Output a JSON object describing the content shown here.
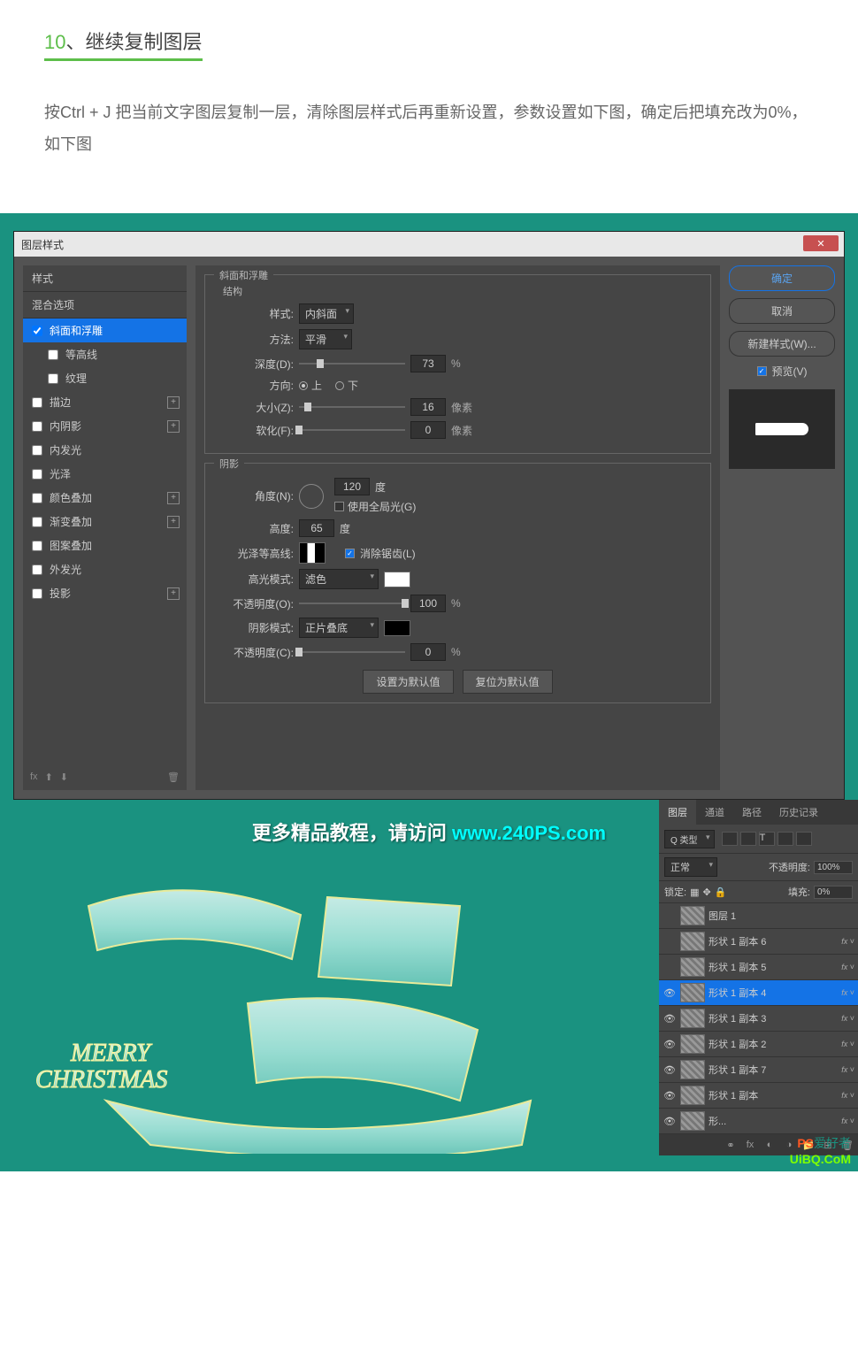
{
  "step": {
    "num": "10",
    "title": "、继续复制图层"
  },
  "desc": "按Ctrl + J 把当前文字图层复制一层，清除图层样式后再重新设置，参数设置如下图，确定后把填充改为0%，如下图",
  "dialog": {
    "title": "图层样式",
    "left": {
      "header1": "样式",
      "header2": "混合选项",
      "items": [
        {
          "label": "斜面和浮雕",
          "checked": true,
          "selected": true
        },
        {
          "label": "等高线",
          "sub": true
        },
        {
          "label": "纹理",
          "sub": true
        },
        {
          "label": "描边",
          "plus": true
        },
        {
          "label": "内阴影",
          "plus": true
        },
        {
          "label": "内发光"
        },
        {
          "label": "光泽"
        },
        {
          "label": "颜色叠加",
          "plus": true
        },
        {
          "label": "渐变叠加",
          "plus": true
        },
        {
          "label": "图案叠加"
        },
        {
          "label": "外发光"
        },
        {
          "label": "投影",
          "plus": true
        }
      ],
      "fx": "fx"
    },
    "bevel": {
      "group": "斜面和浮雕",
      "struct": "结构",
      "style_l": "样式:",
      "style_v": "内斜面",
      "method_l": "方法:",
      "method_v": "平滑",
      "depth_l": "深度(D):",
      "depth_v": "73",
      "depth_u": "%",
      "dir_l": "方向:",
      "dir_up": "上",
      "dir_down": "下",
      "size_l": "大小(Z):",
      "size_v": "16",
      "size_u": "像素",
      "soft_l": "软化(F):",
      "soft_v": "0",
      "soft_u": "像素"
    },
    "shade": {
      "group": "阴影",
      "angle_l": "角度(N):",
      "angle_v": "120",
      "angle_u": "度",
      "global_l": "使用全局光(G)",
      "alt_l": "高度:",
      "alt_v": "65",
      "alt_u": "度",
      "gloss_l": "光泽等高线:",
      "anti_l": "消除锯齿(L)",
      "hmode_l": "高光模式:",
      "hmode_v": "滤色",
      "hopac_l": "不透明度(O):",
      "hopac_v": "100",
      "hopac_u": "%",
      "smode_l": "阴影模式:",
      "smode_v": "正片叠底",
      "sopac_l": "不透明度(C):",
      "sopac_v": "0",
      "sopac_u": "%"
    },
    "btns": {
      "default": "设置为默认值",
      "reset": "复位为默认值"
    },
    "right": {
      "ok": "确定",
      "cancel": "取消",
      "new_style": "新建样式(W)...",
      "preview": "预览(V)"
    }
  },
  "watermark": {
    "text": "更多精品教程，请访问 ",
    "url": "www.240PS.com"
  },
  "art_lines": {
    "l1": "MERRY",
    "l2": "CHRISTMAS"
  },
  "layers": {
    "tabs": [
      "图层",
      "通道",
      "路径",
      "历史记录"
    ],
    "filter_label": "Q 类型",
    "blend": "正常",
    "opacity_l": "不透明度:",
    "opacity_v": "100%",
    "lock_l": "锁定:",
    "fill_l": "填充:",
    "fill_v": "0%",
    "items": [
      {
        "name": "图层 1",
        "eye": false,
        "fx": false
      },
      {
        "name": "形状 1 副本 6",
        "eye": false,
        "fx": true
      },
      {
        "name": "形状 1 副本 5",
        "eye": false,
        "fx": true
      },
      {
        "name": "形状 1 副本 4",
        "eye": true,
        "fx": true,
        "selected": true
      },
      {
        "name": "形状 1 副本 3",
        "eye": true,
        "fx": true
      },
      {
        "name": "形状 1 副本 2",
        "eye": true,
        "fx": true
      },
      {
        "name": "形状 1 副本 7",
        "eye": true,
        "fx": true
      },
      {
        "name": "形状 1 副本",
        "eye": true,
        "fx": true
      },
      {
        "name": "形...",
        "eye": true,
        "fx": true
      }
    ]
  },
  "sitemark": {
    "brand": "PS",
    "rest": "爱好者",
    "domain": "UiBQ.CoM"
  }
}
